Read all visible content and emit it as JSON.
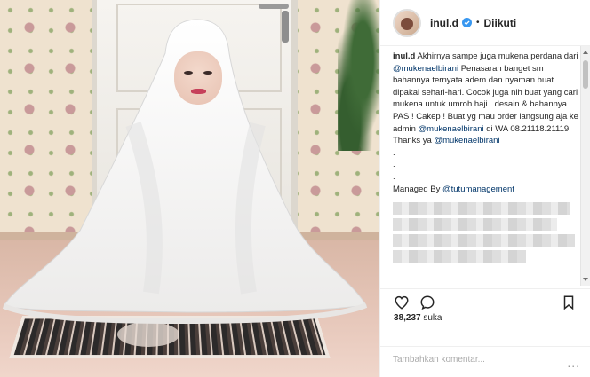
{
  "post": {
    "username": "inul.d",
    "separator": "•",
    "follow_status": "Diikuti",
    "caption_parts": {
      "author": "inul.d",
      "line1": " Akhirnya sampe juga mukena perdana dari ",
      "mention1": "@mukenaelbirani",
      "line2": " Penasaran banget sm bahannya ternyata adem dan nyaman buat dipakai sehari-hari. Cocok juga nih buat yang cari mukena untuk umroh haji.. desain & bahannya PAS ! Cakep ! Buat yg mau order langsung aja ke admin ",
      "mention2": "@mukenaelbirani",
      "line3": " di WA 08.21118.21119",
      "thanks": "Thanks ya ",
      "mention3": "@mukenaelbirani",
      "dot1": ".",
      "dot2": ".",
      "dot3": ".",
      "managed": "Managed By ",
      "mention4": "@tutumanagement"
    },
    "likes_count": "38,237",
    "likes_label": "suka",
    "comment_placeholder": "Tambahkan komentar...",
    "more_label": "..."
  },
  "icons": {
    "like": "heart-icon",
    "comment": "comment-icon",
    "save": "bookmark-icon",
    "verified": "verified-badge-icon"
  },
  "colors": {
    "mention": "#003569",
    "verified": "#3897f0"
  }
}
